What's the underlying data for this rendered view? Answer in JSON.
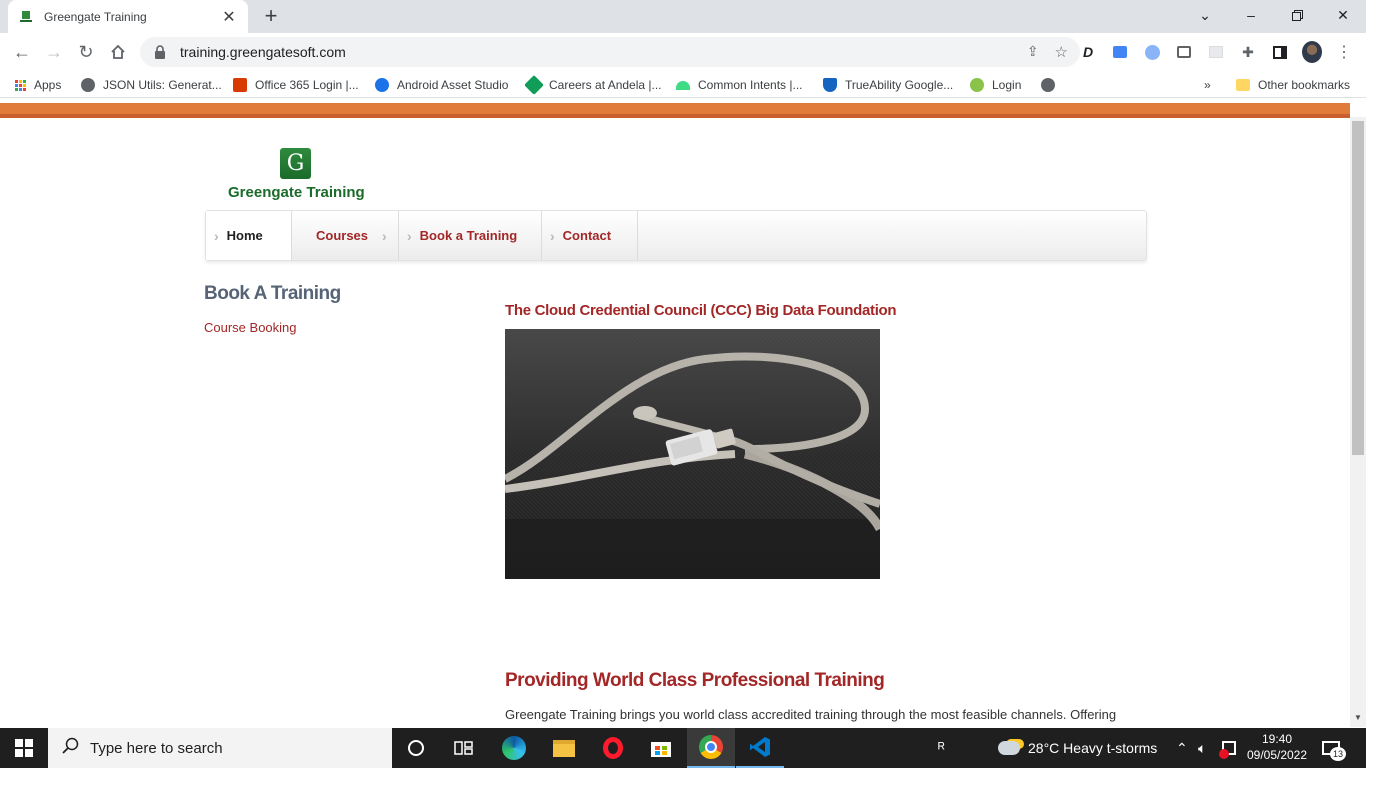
{
  "browser": {
    "tab_title": "Greengate Training",
    "url": "training.greengatesoft.com",
    "bookmarks": [
      {
        "label": "Apps",
        "color": "#ea4335"
      },
      {
        "label": "JSON Utils: Generat...",
        "color": "#5f6368"
      },
      {
        "label": "Office 365 Login |...",
        "color": "#d83b01"
      },
      {
        "label": "Android Asset Studio",
        "color": "#1a73e8"
      },
      {
        "label": "Careers at Andela |...",
        "color": "#0f9d58"
      },
      {
        "label": "Common Intents |...",
        "color": "#3ddc84"
      },
      {
        "label": "TrueAbility Google...",
        "color": "#1565c0"
      },
      {
        "label": "Login",
        "color": "#8bc34a"
      }
    ],
    "more_bookmarks": "»",
    "other_bookmarks": "Other bookmarks"
  },
  "site": {
    "logo_text": "Greengate Training",
    "logo_mark": "G",
    "nav": [
      {
        "label": "Home",
        "active": true
      },
      {
        "label": "Courses",
        "active": false
      },
      {
        "label": "Book a Training",
        "active": false
      },
      {
        "label": "Contact",
        "active": false
      }
    ],
    "sidebar": {
      "title": "Book A Training",
      "link": "Course Booking"
    },
    "course_title": "The Cloud Credential Council (CCC) Big Data Foundation",
    "hero_title": "Providing World Class Professional Training",
    "hero_body": "Greengate Training brings you world class accredited training through the most feasible channels. Offering"
  },
  "taskbar": {
    "search_placeholder": "Type here to search",
    "weather": "28°C  Heavy t-storms",
    "time": "19:40",
    "date": "09/05/2022",
    "notifications": "13"
  },
  "colors": {
    "accent": "#a32727",
    "brand_green": "#1b6b2a",
    "top_bar": "#e07b3c"
  }
}
